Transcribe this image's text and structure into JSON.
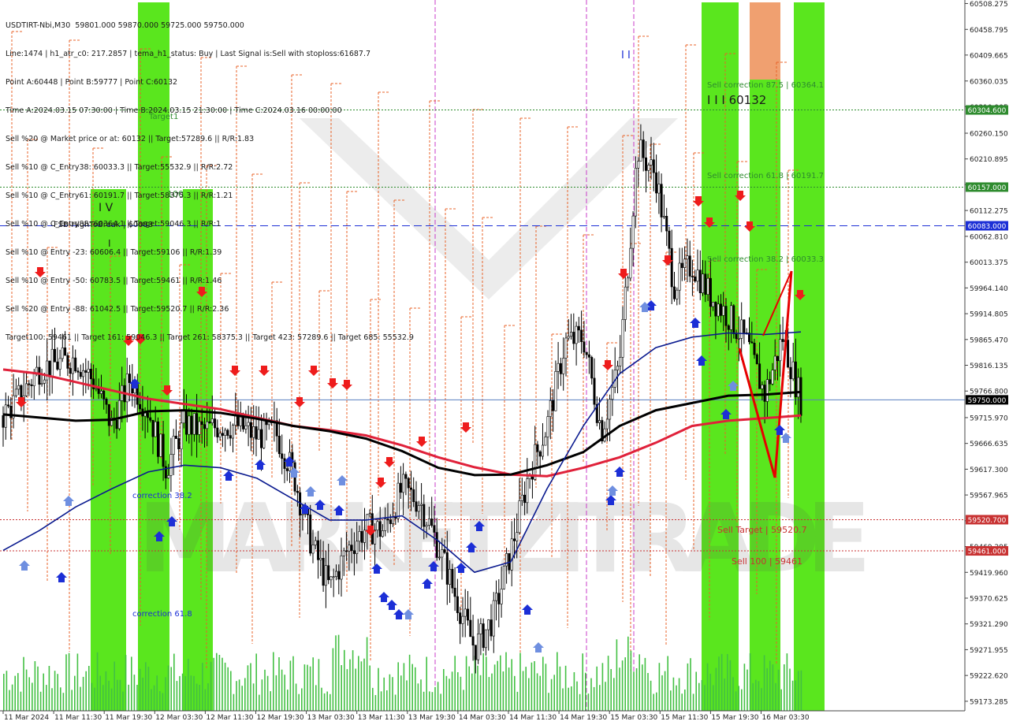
{
  "header": {
    "lines": [
      "USDTIRT-Nbi,M30  59801.000 59870.000 59725.000 59750.000",
      "Line:1474 | h1_atr_c0: 217.2857 | tema_h1_status: Buy | Last Signal is:Sell with stoploss:61687.7",
      "Point A:60448 | Point B:59777 | Point C:60132",
      "Time A:2024.03.15 07:30:00 | Time B:2024.03.15 21:30:00 | Time C:2024.03.16 00:00:00",
      "Sell %20 @ Market price or at: 60132 || Target:57289.6 || R/R:1.83",
      "Sell %10 @ C_Entry38: 60033.3 || Target:55532.9 || R/R:2.72",
      "Sell %10 @ C_Entry61: 60191.7 || Target:58375.3 || R/R:1.21",
      "Sell %10 @ C_Entry88: 60364.1 || Target:59046.3 || R/R:1",
      "Sell %10 @ Entry -23: 60606.4 || Target:59106 || R/R:1.39",
      "Sell %10 @ Entry -50: 60783.5 || Target:59461 || R/R:1.46",
      "Sell %20 @ Entry -88: 61042.5 || Target:59520.7 || R/R:2.36",
      "Target100: 59461 || Target 161: 59046.3 || Target 261: 58375.3 || Target 423: 57289.6 || Target 685: 55532.9"
    ]
  },
  "chart_data": {
    "type": "candlestick",
    "symbol": "USDTIRT-Nbi",
    "timeframe": "M30",
    "ohlc_last": {
      "open": 59801.0,
      "high": 59870.0,
      "low": 59725.0,
      "close": 59750.0
    },
    "ylim": [
      59155,
      60515
    ],
    "y_ticks": [
      60508.275,
      60458.795,
      60409.665,
      60360.035,
      60310.905,
      60260.15,
      60210.895,
      60161.765,
      60112.275,
      60062.81,
      60013.375,
      59964.14,
      59914.805,
      59865.47,
      59816.135,
      59766.8,
      59715.97,
      59666.635,
      59617.3,
      59567.965,
      59518.63,
      59469.295,
      59419.96,
      59370.625,
      59321.29,
      59271.955,
      59222.62,
      59173.285
    ],
    "y_tick_labels": [
      "60508.275",
      "60458.795",
      "60409.665",
      "60360.035",
      "60310.905",
      "60260.150",
      "60210.895",
      "60161.765",
      "60112.275",
      "60062.810",
      "60013.375",
      "59964.140",
      "59914.805",
      "59865.470",
      "59816.135",
      "59766.800",
      "59715.970",
      "59666.635",
      "59617.300",
      "59567.965",
      "59518.630",
      "59469.295",
      "59419.960",
      "59370.625",
      "59321.290",
      "59271.955",
      "59222.620",
      "59173.285"
    ],
    "x_tick_labels": [
      "11 Mar 2024",
      "11 Mar 11:30",
      "11 Mar 19:30",
      "12 Mar 03:30",
      "12 Mar 11:30",
      "12 Mar 19:30",
      "13 Mar 03:30",
      "13 Mar 11:30",
      "13 Mar 19:30",
      "14 Mar 03:30",
      "14 Mar 11:30",
      "14 Mar 19:30",
      "15 Mar 03:30",
      "15 Mar 11:30",
      "15 Mar 19:30",
      "16 Mar 03:30"
    ],
    "price_badges": [
      {
        "value": 60304.6,
        "label": "60304.600",
        "color": "#2e8b2e"
      },
      {
        "value": 60157.0,
        "label": "60157.000",
        "color": "#2e8b2e"
      },
      {
        "value": 60083.0,
        "label": "60083.000",
        "color": "#1c2fd6"
      },
      {
        "value": 59750.0,
        "label": "59750.000",
        "color": "#000000"
      },
      {
        "value": 59520.7,
        "label": "59520.700",
        "color": "#c83232"
      },
      {
        "value": 59461.0,
        "label": "59461.000",
        "color": "#c83232"
      }
    ],
    "levels": [
      {
        "value": 60304.6,
        "color": "#2e8b2e",
        "style": "dotted"
      },
      {
        "value": 60157.0,
        "color": "#2e8b2e",
        "style": "dotted"
      },
      {
        "value": 60083.0,
        "color": "#1c2fd6",
        "style": "dashed"
      },
      {
        "value": 59750.0,
        "color": "#5a7fbf",
        "style": "solid"
      },
      {
        "value": 59520.7,
        "color": "#c83232",
        "style": "dotted"
      },
      {
        "value": 59461.0,
        "color": "#c83232",
        "style": "dotted"
      }
    ],
    "annotations": [
      {
        "text": "FSB-HighToBreak | 60083",
        "color": "#1a1a1a"
      },
      {
        "text": "Sell correction 87.5 | 60364.1",
        "color": "#2e8b2e"
      },
      {
        "text": "Sell correction 61.8 | 60191.7",
        "color": "#2e8b2e"
      },
      {
        "text": "Sell correction 38.2 | 60033.3",
        "color": "#2e8b2e"
      },
      {
        "text": "Sell Target | 59520.7",
        "color": "#c83232"
      },
      {
        "text": "Sell 100 | 59461",
        "color": "#c83232"
      },
      {
        "text": "I I I 60132",
        "color": "#1a1a1a"
      },
      {
        "text": "correction 38.2",
        "color": "#1c2fd6"
      },
      {
        "text": "correction 61.8",
        "color": "#1c2fd6"
      },
      {
        "text": "I V",
        "color": "#1a1a1a"
      },
      {
        "text": "I",
        "color": "#1a1a1a"
      },
      {
        "text": "100",
        "color": "#2e8b2e"
      },
      {
        "text": "Target1",
        "color": "#2e8b2e"
      },
      {
        "text": "I I",
        "color": "#1c2fd6"
      }
    ],
    "ma_series": [
      {
        "color": "#e0213a",
        "values": [
          59808,
          59800,
          59784,
          59768,
          59752,
          59742,
          59732,
          59716,
          59700,
          59692,
          59682,
          59663,
          59640,
          59621,
          59607,
          59604,
          59620,
          59640,
          59668,
          59700,
          59710,
          59715,
          59720
        ]
      },
      {
        "color": "#000000",
        "values": [
          59722,
          59716,
          59710,
          59712,
          59728,
          59730,
          59725,
          59714,
          59700,
          59690,
          59676,
          59652,
          59620,
          59606,
          59607,
          59625,
          59650,
          59700,
          59730,
          59744,
          59758,
          59760,
          59765
        ]
      },
      {
        "color": "#0a1a8f",
        "values": [
          59462,
          59500,
          59545,
          59580,
          59612,
          59625,
          59620,
          59600,
          59560,
          59520,
          59520,
          59528,
          59480,
          59420,
          59440,
          59580,
          59700,
          59800,
          59850,
          59870,
          59878,
          59875,
          59880
        ]
      }
    ],
    "close_series": [
      59720,
      59760,
      59810,
      59820,
      59830,
      59785,
      59700,
      59790,
      59730,
      59620,
      59705,
      59690,
      59702,
      59700,
      59680,
      59690,
      59610,
      59475,
      59390,
      59465,
      59505,
      59500,
      59580,
      59555,
      59470,
      59370,
      59275,
      59330,
      59460,
      59610,
      59700,
      59860,
      59870,
      59690,
      59820,
      60230,
      60180,
      59970,
      60010,
      59950,
      59910,
      59860,
      59760,
      59870,
      59750
    ]
  },
  "watermark": "MARKETZITRADE"
}
